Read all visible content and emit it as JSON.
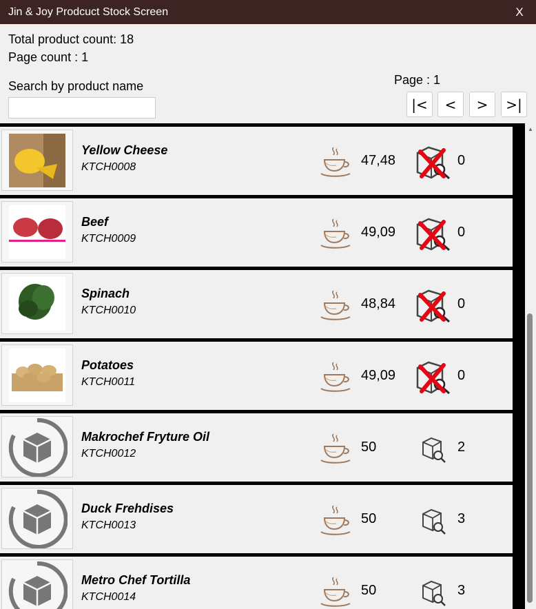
{
  "window": {
    "title": "Jin & Joy Prodcuct Stock Screen",
    "close_label": "X"
  },
  "summary": {
    "total_line": "Total product count: 18",
    "page_count_line": "Page count : 1"
  },
  "search": {
    "label": "Search by product name",
    "value": "",
    "placeholder": ""
  },
  "pagination": {
    "page_label": "Page : 1",
    "first": "|<",
    "prev": "<",
    "next": ">",
    "last": ">|"
  },
  "products": [
    {
      "name": "Yellow Cheese",
      "code": "KTCH0008",
      "price": "47,48",
      "stock": "0",
      "stock_icon": "out-of-stock-icon",
      "image": "cheese"
    },
    {
      "name": "Beef",
      "code": "KTCH0009",
      "price": "49,09",
      "stock": "0",
      "stock_icon": "out-of-stock-icon",
      "image": "beef"
    },
    {
      "name": "Spinach",
      "code": "KTCH0010",
      "price": "48,84",
      "stock": "0",
      "stock_icon": "out-of-stock-icon",
      "image": "spinach"
    },
    {
      "name": "Potatoes",
      "code": "KTCH0011",
      "price": "49,09",
      "stock": "0",
      "stock_icon": "out-of-stock-icon",
      "image": "potatoes"
    },
    {
      "name": "Makrochef Fryture Oil",
      "code": "KTCH0012",
      "price": "50",
      "stock": "2",
      "stock_icon": "stock-search-icon",
      "image": "placeholder-box"
    },
    {
      "name": "Duck Frehdises",
      "code": "KTCH0013",
      "price": "50",
      "stock": "3",
      "stock_icon": "stock-search-icon",
      "image": "placeholder-box"
    },
    {
      "name": "Metro Chef Tortilla",
      "code": "KTCH0014",
      "price": "50",
      "stock": "3",
      "stock_icon": "stock-search-icon",
      "image": "placeholder-box"
    }
  ],
  "colors": {
    "titlebar": "#3c2423",
    "cup": "#a0785a",
    "cross": "#e30613",
    "row_separator": "#000000"
  }
}
